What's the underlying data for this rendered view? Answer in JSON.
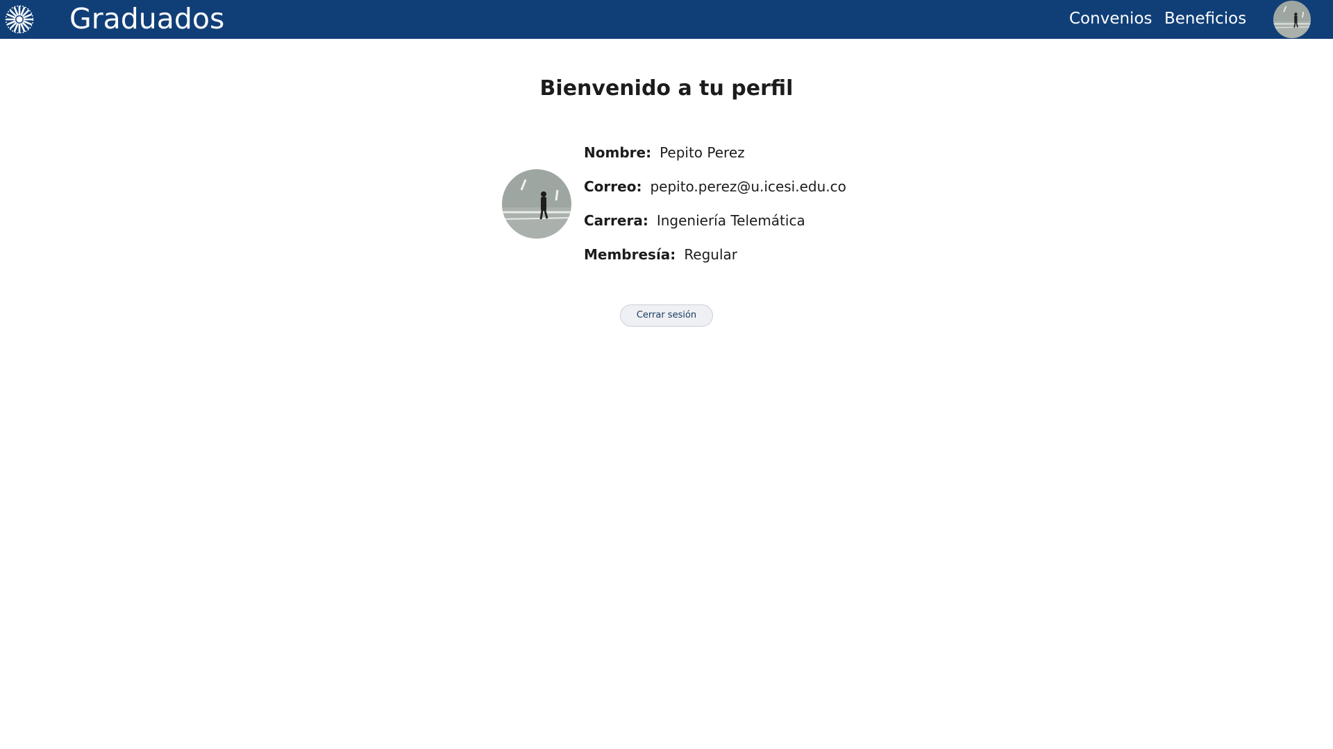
{
  "navbar": {
    "brand": "Graduados",
    "links": [
      "Convenios",
      "Beneficios"
    ],
    "logo_icon": "sunburst-logo-icon",
    "avatar_icon": "profile-photo-avatar"
  },
  "profile": {
    "title": "Bienvenido a tu perfil",
    "fields": [
      {
        "label": "Nombre:",
        "value": "Pepito Perez"
      },
      {
        "label": "Correo:",
        "value": "pepito.perez@u.icesi.edu.co"
      },
      {
        "label": "Carrera:",
        "value": "Ingeniería Telemática"
      },
      {
        "label": "Membresía:",
        "value": "Regular"
      }
    ],
    "logout_label": "Cerrar sesión"
  },
  "colors": {
    "navbar_bg": "#103f78",
    "text": "#1c1c1c",
    "button_bg": "#eef0f4",
    "button_text": "#1a3a63"
  }
}
